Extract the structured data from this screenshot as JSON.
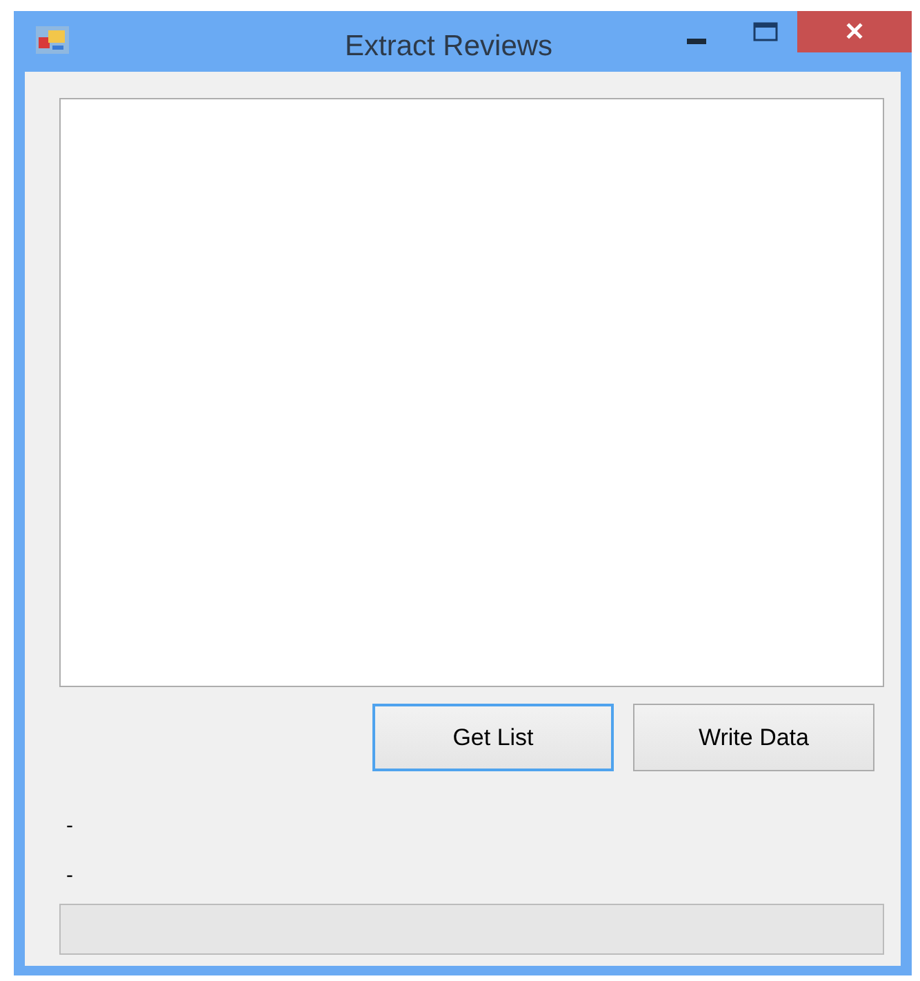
{
  "window": {
    "title": "Extract Reviews",
    "close_label": "✕"
  },
  "buttons": [
    {
      "label": "Get List",
      "focused": true
    },
    {
      "label": "Write Data",
      "focused": false
    }
  ],
  "status_labels": [
    "-",
    "-"
  ]
}
